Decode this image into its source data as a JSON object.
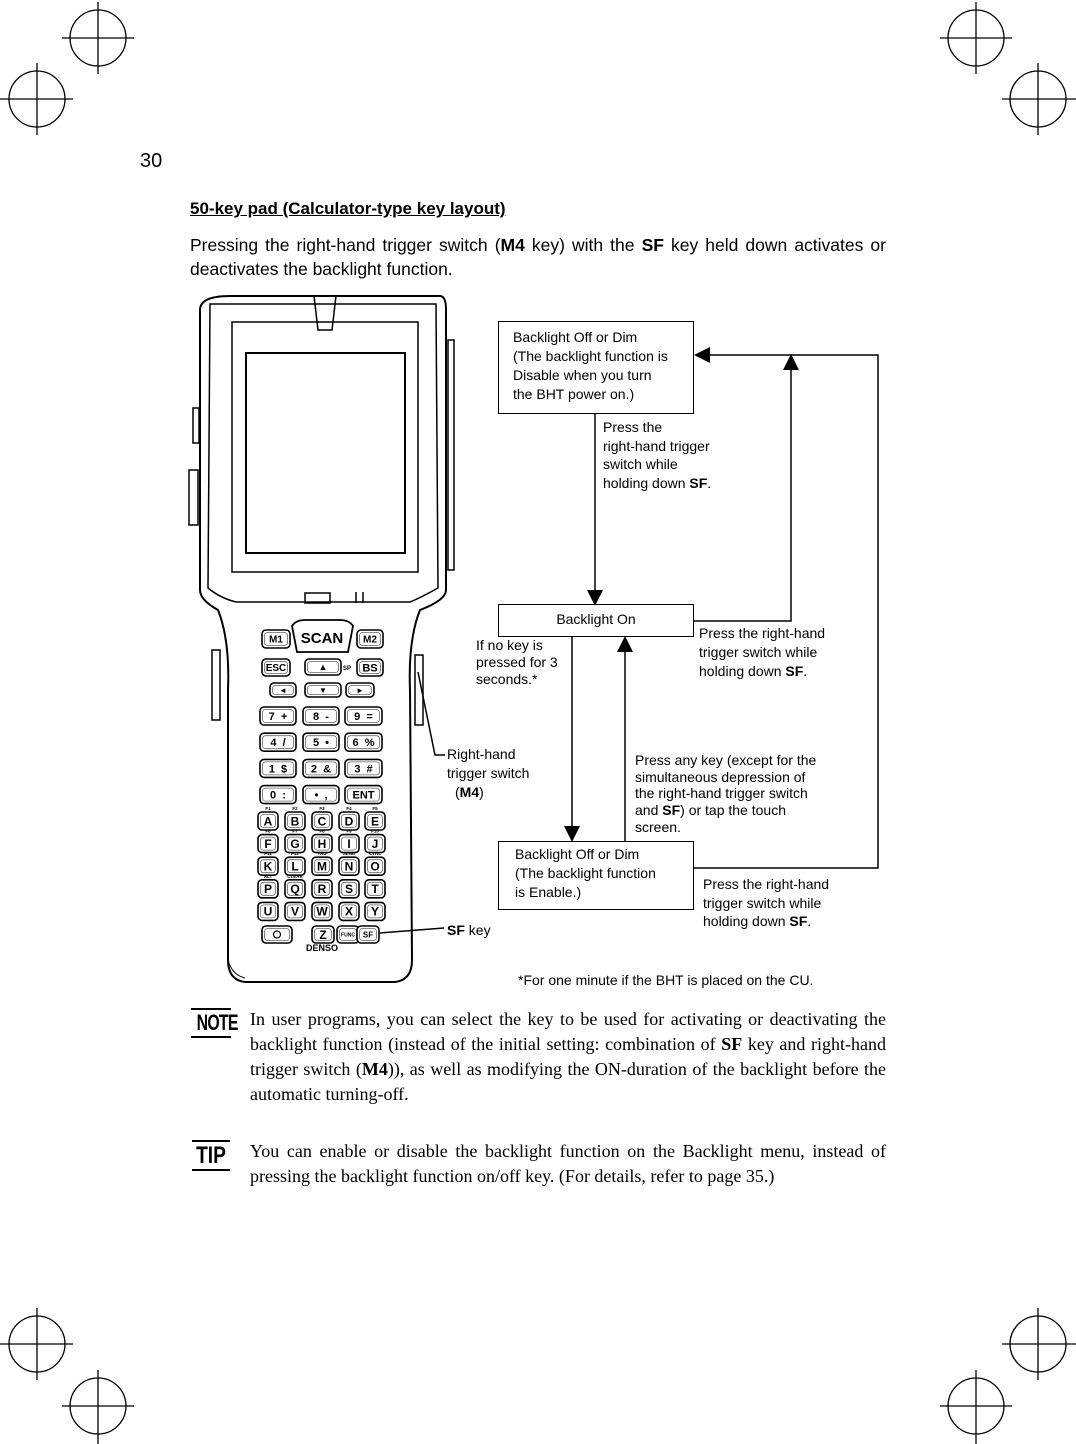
{
  "page_number": "30",
  "section_title": "50-key pad (Calculator-type key layout)",
  "intro": {
    "part1": "Pressing the right-hand trigger switch (",
    "m4": "M4",
    "part2": " key) with the ",
    "sf": "SF",
    "part3": " key held down activates or deactivates the backlight function."
  },
  "device": {
    "brand": "DENSO",
    "keys_top": [
      "M1",
      "SCAN",
      "M2"
    ],
    "keys_nav1": [
      "ESC",
      "▲",
      "SP",
      "BS"
    ],
    "keys_nav2": [
      "◄",
      "▼",
      "►"
    ],
    "keys_num": [
      [
        "7  +",
        "8  -",
        "9  ="
      ],
      [
        "4  /",
        "5  •",
        "6  %"
      ],
      [
        "1  $",
        "2  &",
        "3  #"
      ],
      [
        "0  :",
        "•  ,",
        "ENT"
      ]
    ],
    "keys_alpha": [
      [
        "A",
        "B",
        "C",
        "D",
        "E"
      ],
      [
        "F",
        "G",
        "H",
        "I",
        "J"
      ],
      [
        "K",
        "L",
        "M",
        "N",
        "O"
      ],
      [
        "P",
        "Q",
        "R",
        "S",
        "T"
      ],
      [
        "U",
        "V",
        "W",
        "X",
        "Y"
      ]
    ],
    "keys_alpha_sub": [
      [
        "F1",
        "F2",
        "F3",
        "F4",
        "F5"
      ],
      [
        "F6",
        "F7",
        "F8",
        "F9",
        "F10"
      ],
      [
        "F11",
        "F12",
        "TAB",
        "SEND",
        "CTRL"
      ],
      [
        "ALT",
        "CLEAR",
        "",
        "",
        ""
      ]
    ],
    "keys_bottom": [
      "power-icon",
      "Z",
      "FUNC",
      "SF"
    ]
  },
  "callouts": {
    "trigger_line1": "Right-hand",
    "trigger_line2": "trigger switch",
    "trigger_key": "M4",
    "sf_key": "SF",
    "sf_suffix": " key"
  },
  "diagram": {
    "state_off_initial": [
      "Backlight Off or Dim",
      "(The backlight function is",
      "Disable when you turn",
      "the BHT power on.)"
    ],
    "state_on": "Backlight On",
    "state_off_enabled": [
      "Backlight Off or Dim",
      "(The backlight function",
      "is Enable.)"
    ],
    "label_press_sf_top": [
      "Press the",
      "right-hand trigger",
      "switch while",
      "holding down "
    ],
    "label_no_key": [
      "If no key is",
      "pressed for 3",
      "seconds.*"
    ],
    "label_press_right_mid": [
      "Press the right-hand",
      "trigger switch while",
      "holding down "
    ],
    "label_press_any": [
      "Press any key (except for the",
      "simultaneous depression of",
      "the right-hand trigger switch",
      "and ",
      ") or tap the touch",
      "screen."
    ],
    "label_press_right_bottom": [
      "Press the right-hand",
      "trigger switch while",
      "holding down "
    ],
    "sf": "SF",
    "footnote": "*For one minute if the BHT is placed on the CU."
  },
  "note": {
    "icon": "NOTE",
    "t1": "In user programs, you can select the key to be used for activating or deactivating the backlight function (instead of the initial setting: combination of ",
    "sf": "SF",
    "t2": " key and right-hand trigger switch (",
    "m4": "M4",
    "t3": ")), as well as modifying the ON-duration of the backlight before the automatic turning-off."
  },
  "tip": {
    "icon": "TIP",
    "text": "You can enable or disable the backlight function on the Backlight menu, instead of pressing the backlight function on/off key. (For details, refer to page 35.)"
  }
}
